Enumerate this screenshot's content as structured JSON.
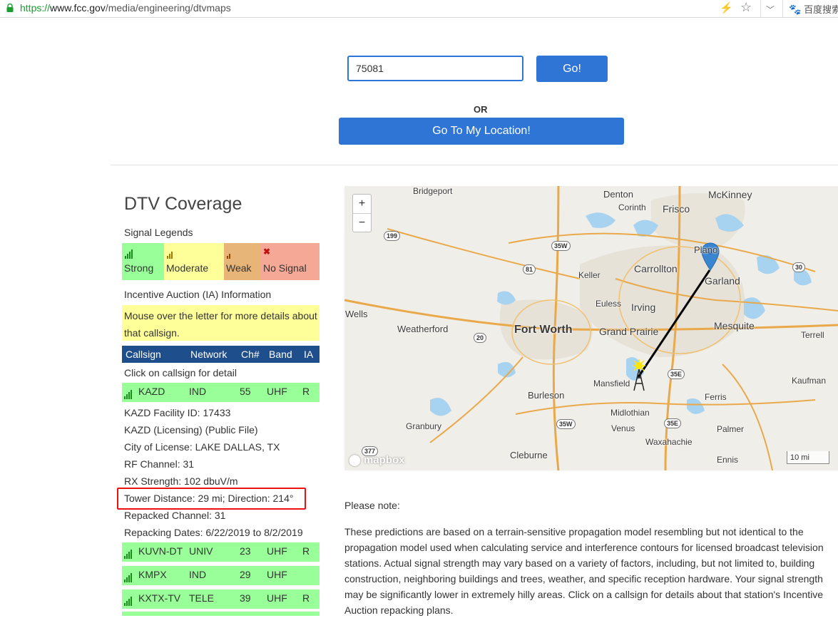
{
  "browser": {
    "url_scheme": "https://",
    "url_host": "www.fcc.gov",
    "url_path": "/media/engineering/dtvmaps",
    "search_engine_label": "百度搜索"
  },
  "search": {
    "zip_value": "75081",
    "go_label": "Go!",
    "or_label": "OR",
    "location_label": "Go To My Location!"
  },
  "panel": {
    "title": "DTV Coverage",
    "legends_label": "Signal Legends",
    "legend": [
      {
        "label": "Strong",
        "color": "#99ff99"
      },
      {
        "label": "Moderate",
        "color": "#ffff99"
      },
      {
        "label": "Weak",
        "color": "#e8b579"
      },
      {
        "label": "No Signal",
        "color": "#f5a896"
      }
    ],
    "ia_label": "Incentive Auction (IA) Information",
    "mouse_note": "Mouse over the letter for more details about that callsign.",
    "columns": [
      "Callsign",
      "Network",
      "Ch#",
      "Band",
      "IA"
    ],
    "click_note": "Click on callsign for detail"
  },
  "stations": [
    {
      "callsign": "KAZD",
      "network": "IND",
      "ch": "55",
      "band": "UHF",
      "ia": "R"
    },
    {
      "callsign": "KUVN-DT",
      "network": "UNIV",
      "ch": "23",
      "band": "UHF",
      "ia": "R"
    },
    {
      "callsign": "KMPX",
      "network": "IND",
      "ch": "29",
      "band": "UHF",
      "ia": ""
    },
    {
      "callsign": "KXTX-TV",
      "network": "TELE",
      "ch": "39",
      "band": "UHF",
      "ia": "R"
    }
  ],
  "detail": {
    "facility": "KAZD Facility ID: 17433",
    "licensing_prefix": "KAZD ",
    "licensing_link": "(Licensing)",
    "public_file_link": "(Public File)",
    "city": "City of License: LAKE DALLAS, TX",
    "rf": "RF Channel: 31",
    "rx": "RX Strength: 102 dbuV/m",
    "tower": "Tower Distance: 29 mi; Direction: 214°",
    "repacked": "Repacked Channel: 31",
    "dates": "Repacking Dates: 6/22/2019 to 8/2/2019"
  },
  "map": {
    "zoom_in": "+",
    "zoom_out": "−",
    "attribution": "mapbox",
    "scale": "10 mi",
    "cities": [
      {
        "name": "Denton"
      },
      {
        "name": "McKinney"
      },
      {
        "name": "Frisco"
      },
      {
        "name": "Corinth"
      },
      {
        "name": "Bridgeport"
      },
      {
        "name": "Plano"
      },
      {
        "name": "Carrollton"
      },
      {
        "name": "Keller"
      },
      {
        "name": "Garland"
      },
      {
        "name": "Euless"
      },
      {
        "name": "Irving"
      },
      {
        "name": "Wells"
      },
      {
        "name": "Fort Worth"
      },
      {
        "name": "Grand Prairie"
      },
      {
        "name": "Mesquite"
      },
      {
        "name": "Weatherford"
      },
      {
        "name": "Terrell"
      },
      {
        "name": "Mansfield"
      },
      {
        "name": "Burleson"
      },
      {
        "name": "Ferris"
      },
      {
        "name": "Kaufman"
      },
      {
        "name": "Midlothian"
      },
      {
        "name": "Granbury"
      },
      {
        "name": "Venus"
      },
      {
        "name": "Palmer"
      },
      {
        "name": "Waxahachie"
      },
      {
        "name": "Cleburne"
      },
      {
        "name": "Ennis"
      }
    ],
    "shields": [
      "199",
      "35W",
      "81",
      "30",
      "20",
      "35E",
      "35W",
      "35E",
      "377"
    ]
  },
  "notice": {
    "heading": "Please note:",
    "body": "These predictions are based on a terrain-sensitive propagation model resembling but not identical to the propagation model used when calculating service and interference contours for licensed broadcast television stations. Actual signal strength may vary based on a variety of factors, including, but not limited to, building construction, neighboring buildings and trees, weather, and specific reception hardware. Your signal strength may be significantly lower in extremely hilly areas. Click on a callsign for details about that station's Incentive Auction repacking plans."
  }
}
